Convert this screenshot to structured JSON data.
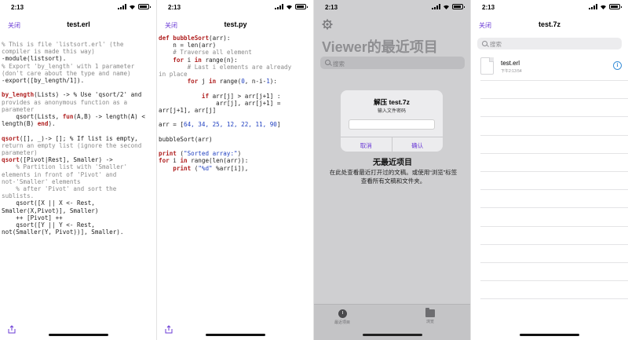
{
  "status_time": "2:13",
  "screens": {
    "erlang": {
      "back": "关闭",
      "title": "test.erl",
      "lines": [
        [
          {
            "t": "% This is file 'listsort.erl' (the",
            "c": "cm"
          }
        ],
        [
          {
            "t": "compiler is made this way)",
            "c": "cm"
          }
        ],
        [
          {
            "t": "-module",
            "c": ""
          },
          {
            "t": "(listsort).",
            "c": ""
          }
        ],
        [
          {
            "t": "% Export 'by_length' with 1 parameter",
            "c": "cm"
          }
        ],
        [
          {
            "t": "(don't care about the type and name)",
            "c": "cm"
          }
        ],
        [
          {
            "t": "-export",
            "c": ""
          },
          {
            "t": "([by_length/1]).",
            "c": ""
          }
        ],
        [
          {
            "t": "",
            "c": ""
          }
        ],
        [
          {
            "t": "by_length",
            "c": "kw"
          },
          {
            "t": "(Lists) -> % Use 'qsort/2' and",
            "c": ""
          }
        ],
        [
          {
            "t": "provides as anonymous function as a",
            "c": "cm"
          }
        ],
        [
          {
            "t": "parameter",
            "c": "cm"
          }
        ],
        [
          {
            "t": "    qsort(Lists, ",
            "c": ""
          },
          {
            "t": "fun",
            "c": "kw"
          },
          {
            "t": "(A,B) -> length(A) <",
            "c": ""
          }
        ],
        [
          {
            "t": "length(B) ",
            "c": ""
          },
          {
            "t": "end",
            "c": "kw"
          },
          {
            "t": ").",
            "c": ""
          }
        ],
        [
          {
            "t": "",
            "c": ""
          }
        ],
        [
          {
            "t": "qsort",
            "c": "kw"
          },
          {
            "t": "([], _)-> []; % If list is empty,",
            "c": ""
          }
        ],
        [
          {
            "t": "return an empty list (ignore the second",
            "c": "cm"
          }
        ],
        [
          {
            "t": "parameter)",
            "c": "cm"
          }
        ],
        [
          {
            "t": "qsort",
            "c": "kw"
          },
          {
            "t": "([Pivot|Rest], Smaller) ->",
            "c": ""
          }
        ],
        [
          {
            "t": "    % Partition list with 'Smaller'",
            "c": "cm"
          }
        ],
        [
          {
            "t": "elements in front of 'Pivot' and",
            "c": "cm"
          }
        ],
        [
          {
            "t": "not-'Smaller' elements",
            "c": "cm"
          }
        ],
        [
          {
            "t": "    % after 'Pivot' and sort the",
            "c": "cm"
          }
        ],
        [
          {
            "t": "sublists.",
            "c": "cm"
          }
        ],
        [
          {
            "t": "    qsort([X || X <- Rest,",
            "c": ""
          }
        ],
        [
          {
            "t": "Smaller(X,Pivot)], Smaller)",
            "c": ""
          }
        ],
        [
          {
            "t": "    ++ [Pivot] ++",
            "c": ""
          }
        ],
        [
          {
            "t": "    qsort([Y || Y <- Rest,",
            "c": ""
          }
        ],
        [
          {
            "t": "not(Smaller(Y, Pivot))], Smaller).",
            "c": ""
          }
        ]
      ]
    },
    "python": {
      "back": "关闭",
      "title": "test.py",
      "lines": [
        [
          {
            "t": "def ",
            "c": "kw"
          },
          {
            "t": "bubbleSort",
            "c": "kw"
          },
          {
            "t": "(arr):",
            "c": ""
          }
        ],
        [
          {
            "t": "    n = len(arr)",
            "c": ""
          }
        ],
        [
          {
            "t": "    # Traverse all element",
            "c": "cm"
          }
        ],
        [
          {
            "t": "    ",
            "c": ""
          },
          {
            "t": "for",
            "c": "kw"
          },
          {
            "t": " i ",
            "c": ""
          },
          {
            "t": "in",
            "c": "kw"
          },
          {
            "t": " range(n):",
            "c": ""
          }
        ],
        [
          {
            "t": "        # Last i elements are already",
            "c": "cm"
          }
        ],
        [
          {
            "t": "in place",
            "c": "cm"
          }
        ],
        [
          {
            "t": "        ",
            "c": ""
          },
          {
            "t": "for",
            "c": "kw"
          },
          {
            "t": " j ",
            "c": ""
          },
          {
            "t": "in",
            "c": "kw"
          },
          {
            "t": " range(",
            "c": ""
          },
          {
            "t": "0",
            "c": "str"
          },
          {
            "t": ", n-i-",
            "c": ""
          },
          {
            "t": "1",
            "c": "str"
          },
          {
            "t": "):",
            "c": ""
          }
        ],
        [
          {
            "t": "",
            "c": ""
          }
        ],
        [
          {
            "t": "            ",
            "c": ""
          },
          {
            "t": "if",
            "c": "kw"
          },
          {
            "t": " arr[j] > arr[j+1] :",
            "c": ""
          }
        ],
        [
          {
            "t": "                arr[j], arr[j+1] =",
            "c": ""
          }
        ],
        [
          {
            "t": "arr[j+1], arr[j]",
            "c": ""
          }
        ],
        [
          {
            "t": "",
            "c": ""
          }
        ],
        [
          {
            "t": "arr = [",
            "c": ""
          },
          {
            "t": "64, 34, 25, 12, 22, 11, 90",
            "c": "str"
          },
          {
            "t": "]",
            "c": ""
          }
        ],
        [
          {
            "t": "",
            "c": ""
          }
        ],
        [
          {
            "t": "bubbleSort(arr)",
            "c": ""
          }
        ],
        [
          {
            "t": "",
            "c": ""
          }
        ],
        [
          {
            "t": "print",
            "c": "kw"
          },
          {
            "t": " (",
            "c": ""
          },
          {
            "t": "\"Sorted array:\"",
            "c": "str"
          },
          {
            "t": ")",
            "c": ""
          }
        ],
        [
          {
            "t": "for",
            "c": "kw"
          },
          {
            "t": " i ",
            "c": ""
          },
          {
            "t": "in",
            "c": "kw"
          },
          {
            "t": " range(len(arr)):",
            "c": ""
          }
        ],
        [
          {
            "t": "    ",
            "c": ""
          },
          {
            "t": "print",
            "c": "kw"
          },
          {
            "t": " (",
            "c": ""
          },
          {
            "t": "\"%d\"",
            "c": "str"
          },
          {
            "t": " %arr[i]),",
            "c": ""
          }
        ]
      ]
    },
    "recents": {
      "title": "Viewer的最近项目",
      "search_placeholder": "搜索",
      "dialog": {
        "title": "解压 test.7z",
        "message": "输入文件密码",
        "cancel": "取消",
        "confirm": "确认"
      },
      "empty_title": "无最近项目",
      "empty_message": "在此处查看最近打开过的文稿。或使用“浏览”标签查看所有文稿和文件夹。",
      "tabs": [
        {
          "label": "最近项目",
          "icon": "clock-icon"
        },
        {
          "label": "浏览",
          "icon": "folder-icon"
        }
      ]
    },
    "archive": {
      "back": "关闭",
      "title": "test.7z",
      "search_placeholder": "搜索",
      "file": {
        "name": "test.erl",
        "date": "下午2:13:54",
        "icon": "document-icon"
      }
    }
  },
  "colors": {
    "accent": "#6b3bd6",
    "info": "#3a8fd8",
    "keyword": "#b02020",
    "comment": "#8a8a8a",
    "number": "#2040c0"
  }
}
